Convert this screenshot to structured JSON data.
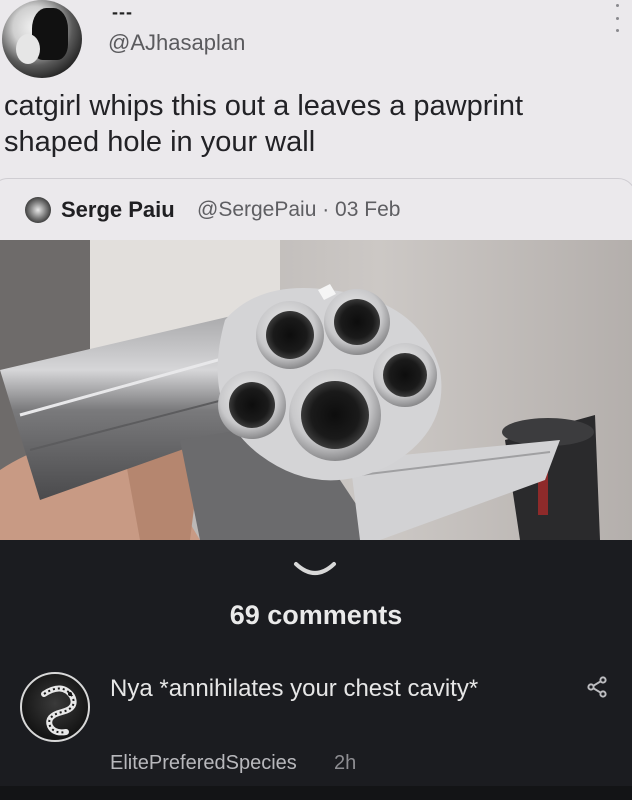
{
  "tweet": {
    "display_name": "---",
    "handle": "@AJhasaplan",
    "text": "catgirl whips this out a leaves a pawprint shaped hole in your wall"
  },
  "quote": {
    "name": "Serge Paiu",
    "meta": "@SergePaiu · 03 Feb"
  },
  "comments": {
    "count_label": "69 comments",
    "items": [
      {
        "text": "Nya *annihilates your chest cavity*",
        "author": "ElitePreferedSpecies",
        "time": "2h"
      }
    ]
  },
  "icons": {
    "more": "more-vertical-icon",
    "chevron": "chevron-down-icon",
    "share": "share-icon"
  },
  "colors": {
    "tweet_bg": "#ebe9ec",
    "dark_bg": "#1b1c20",
    "text_dark": "#222226",
    "text_light": "#e6e6e6"
  }
}
